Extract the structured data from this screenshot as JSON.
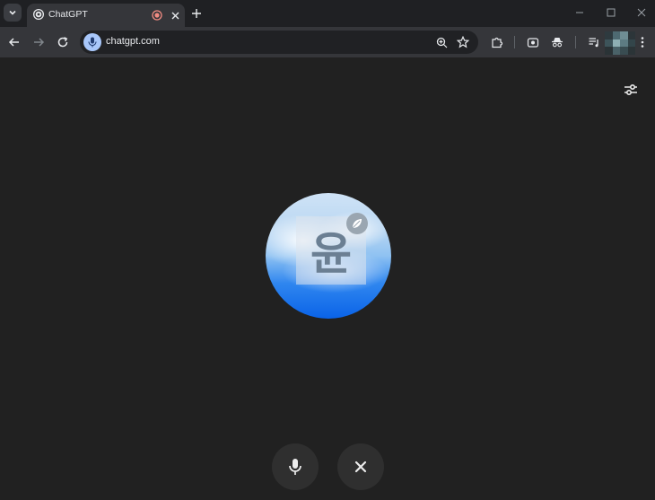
{
  "browser": {
    "tab": {
      "title": "ChatGPT"
    },
    "address_bar": {
      "url": "chatgpt.com"
    }
  },
  "voice_mode": {
    "avatar_character": "윤"
  },
  "icons": {
    "tab_search": "chevron-down-icon",
    "favicon": "openai-logo-icon",
    "recording": "recording-indicator-icon",
    "tab_close": "close-icon",
    "new_tab": "plus-icon",
    "minimize": "minimize-icon",
    "maximize": "maximize-icon",
    "window_close": "close-icon",
    "back": "arrow-left-icon",
    "forward": "arrow-right-icon",
    "reload": "reload-icon",
    "site_info": "microphone-icon",
    "zoom": "zoom-icon",
    "bookmark": "star-icon",
    "extensions": "puzzle-icon",
    "screen_capture": "camera-icon",
    "incognito": "spy-icon",
    "media": "media-queue-icon",
    "menu": "more-vert-icon",
    "settings": "sliders-icon",
    "mic": "microphone-icon",
    "end": "close-icon"
  },
  "colors": {
    "page_background": "#212121",
    "button_background": "#2f2f2f",
    "orb_blue": "#0a63e8"
  }
}
